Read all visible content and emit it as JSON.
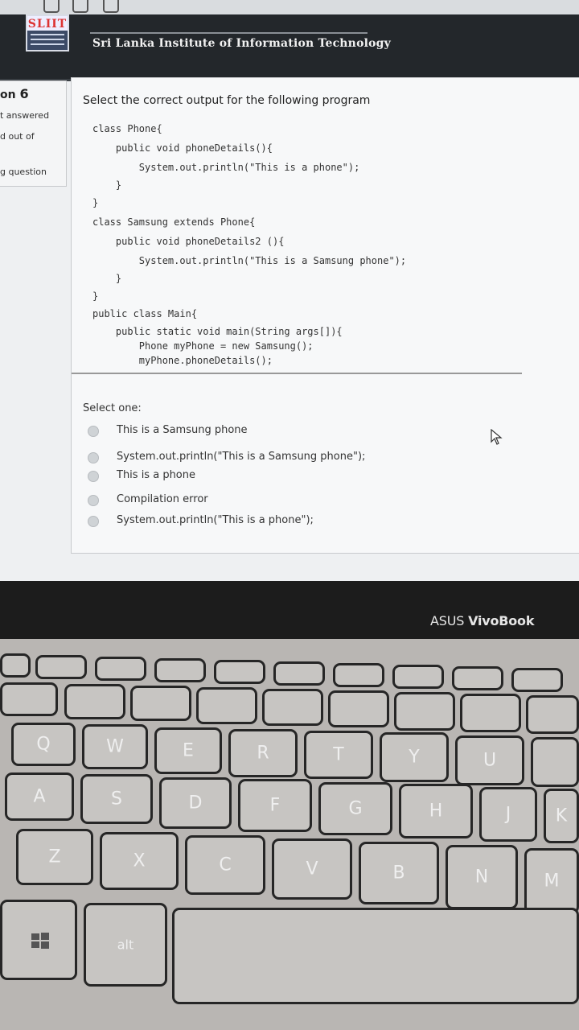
{
  "header": {
    "logo_text": "SLIIT",
    "institution": "Sri Lanka Institute of Information Technology"
  },
  "question_info": {
    "label": "on",
    "number": "6",
    "status": "t answered",
    "marks": "d out of",
    "flag": "g question"
  },
  "question": {
    "prompt": "Select the correct output for the following program",
    "code_lines": [
      "class Phone{",
      "    public void phoneDetails(){",
      "        System.out.println(\"This is a phone\");",
      "    }",
      "}",
      "class Samsung extends Phone{",
      "    public void phoneDetails2 (){",
      "        System.out.println(\"This is a Samsung phone\");",
      "    }",
      "}",
      "public class Main{",
      "    public static void main(String args[]){",
      "        Phone myPhone = new Samsung();",
      "        myPhone.phoneDetails();",
      "    }",
      "}"
    ],
    "select_label": "Select one:",
    "options": [
      "This is a Samsung phone",
      "System.out.println(\"This is a Samsung phone\");",
      "This is a phone",
      "Compilation error",
      "System.out.println(\"This is a phone\");"
    ]
  },
  "laptop": {
    "brand_prefix": "ASUS",
    "brand_model": "VivoBook",
    "keys": {
      "row_q": [
        "Q",
        "W",
        "E",
        "R",
        "T",
        "Y",
        "U"
      ],
      "row_a": [
        "A",
        "S",
        "D",
        "F",
        "G",
        "H",
        "J",
        "K"
      ],
      "row_z": [
        "Z",
        "X",
        "C",
        "V",
        "B",
        "N",
        "M"
      ],
      "alt": "alt"
    }
  },
  "icons": [
    "windows-key-icon",
    "mouse-cursor-icon",
    "radio-icon"
  ]
}
